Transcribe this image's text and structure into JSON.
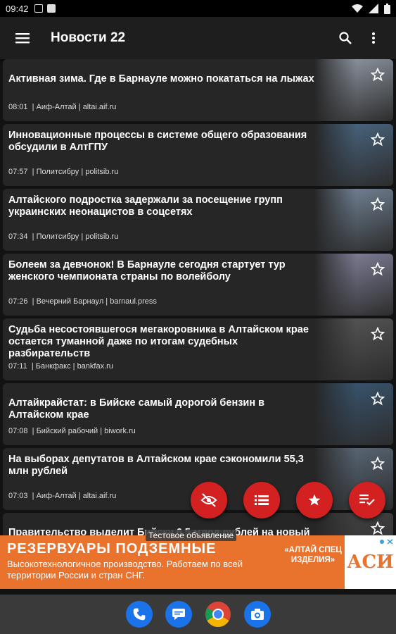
{
  "status": {
    "time": "09:42"
  },
  "appbar": {
    "title": "Новости 22"
  },
  "news": [
    {
      "title": "Активная зима. Где в Барнауле можно покататься на лыжах",
      "time": "08:01",
      "source": "Аиф-Алтай",
      "domain": "altai.aif.ru",
      "thumb": "#9aa3b0"
    },
    {
      "title": "Инновационные процессы в системе общего образования обсудили в АлтГПУ",
      "time": "07:57",
      "source": "Политсибру",
      "domain": "politsib.ru",
      "thumb": "#4d6c8a"
    },
    {
      "title": "Алтайского подростка задержали за посещение групп украинских неонацистов в соцсетях",
      "time": "07:34",
      "source": "Политсибру",
      "domain": "politsib.ru",
      "thumb": "#7a8ea3"
    },
    {
      "title": "Болеем за девчонок! В Барнауле сегодня стартует тур женского чемпионата страны по волейболу",
      "time": "07:26",
      "source": "Вечерний Барнаул",
      "domain": "barnaul.press",
      "thumb": "#8a8aa6"
    },
    {
      "title": "Судьба несостоявшегося мегакоровника в Алтайском крае остается туманной даже по итогам судебных разбирательств",
      "time": "07:11",
      "source": "Банкфакс",
      "domain": "bankfax.ru",
      "thumb": "#5a5a5a"
    },
    {
      "title": "Алтайкрайстат: в Бийске самый дорогой бензин в Алтайском крае",
      "time": "07:08",
      "source": "Бийский рабочий",
      "domain": "biwork.ru",
      "thumb": "#3b5a78"
    },
    {
      "title": "На выборах депутатов в Алтайском крае сэкономили 55,3 млн рублей",
      "time": "07:03",
      "source": "Аиф-Алтай",
      "domain": "altai.aif.ru",
      "thumb": "#5f6f80"
    },
    {
      "title": "Правительство выделит Бийску 6,5 млрд рублей на новый",
      "time": "",
      "source": "",
      "domain": "",
      "thumb": "#444"
    }
  ],
  "ad": {
    "label": "Тестовое объявление",
    "headline": "РЕЗЕРВУАРЫ ПОДЗЕМНЫЕ",
    "body": "Высокотехнологичное производство. Работаем по всей территории России и стран СНГ.",
    "brand": "«АЛТАЙ СПЕЦ ИЗДЕЛИЯ»",
    "logo": "АСИ",
    "color": "#e9722d"
  },
  "colors": {
    "fab": "#d32020",
    "appbar": "#1e1e1e",
    "card": "#262626"
  },
  "fabs": [
    "visibility-off-icon",
    "list-icon",
    "star-icon",
    "playlist-check-icon"
  ],
  "dock": [
    "phone-icon",
    "messages-icon",
    "chrome-icon",
    "camera-icon"
  ]
}
